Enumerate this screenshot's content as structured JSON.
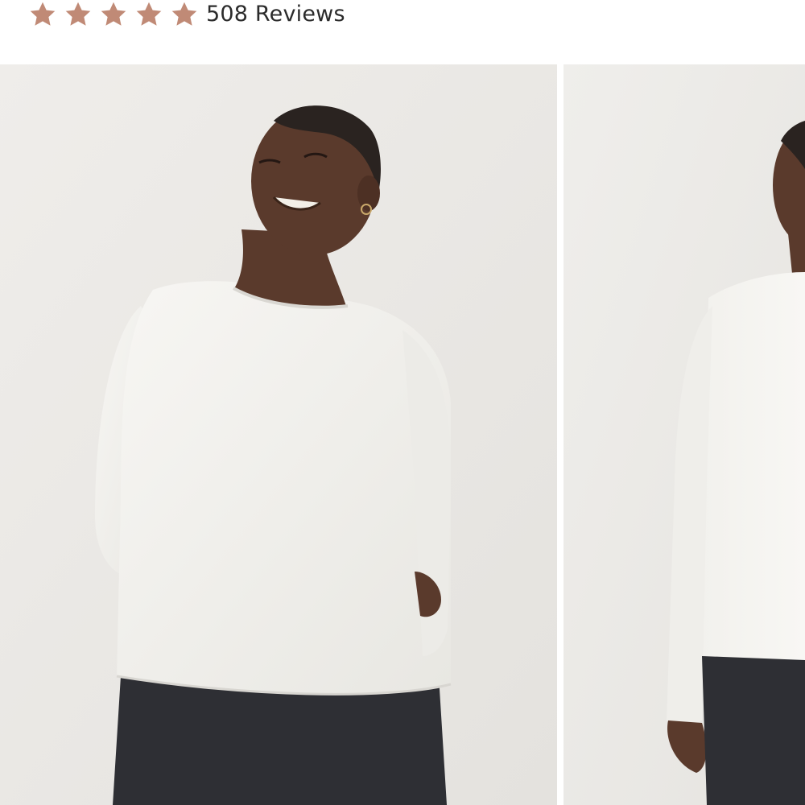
{
  "rating": {
    "stars_filled": 5,
    "stars_total": 5,
    "star_color": "#c08a76",
    "review_count_text": "508 Reviews",
    "star_icon": "star-icon"
  },
  "gallery": {
    "images": [
      {
        "name": "product-photo-front",
        "background": "#ebe9e6"
      },
      {
        "name": "product-photo-back",
        "background": "#eceae7"
      }
    ]
  },
  "colors": {
    "shirt": "#f4f3ef",
    "leggings": "#2e2f34",
    "skin": "#5a3a2c"
  }
}
